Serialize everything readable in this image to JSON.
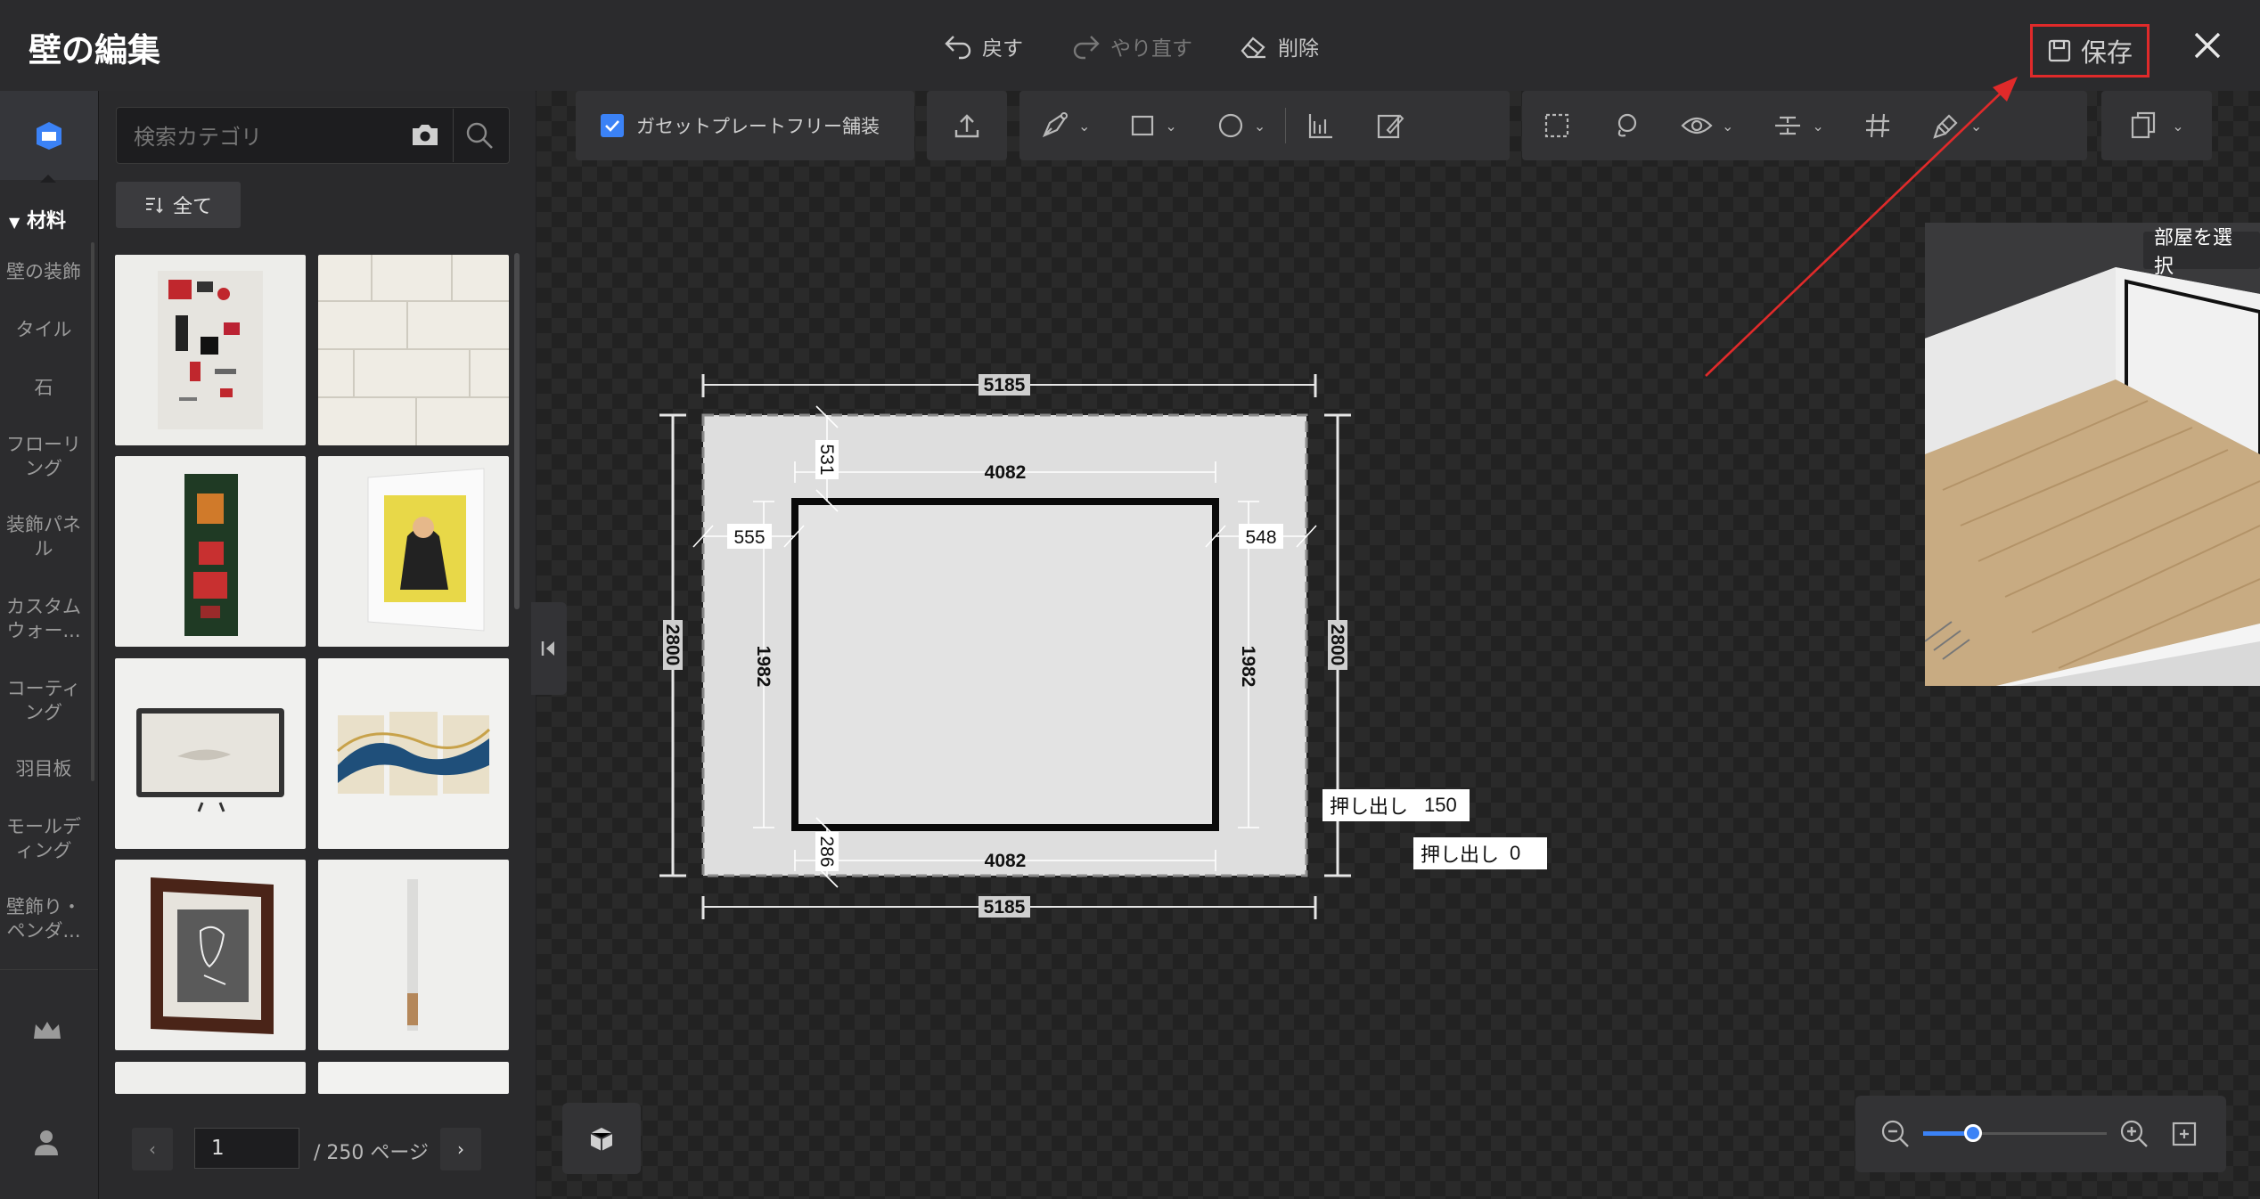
{
  "header": {
    "title": "壁の編集",
    "undo_label": "戻す",
    "redo_label": "やり直す",
    "delete_label": "削除",
    "save_label": "保存"
  },
  "rail": {
    "category_header": "材料",
    "categories": [
      [
        "壁の装飾"
      ],
      [
        "タイル"
      ],
      [
        "石"
      ],
      [
        "フローリ",
        "ング"
      ],
      [
        "装飾パネ",
        "ル"
      ],
      [
        "カスタム",
        "ウォー..."
      ],
      [
        "コーティ",
        "ング"
      ],
      [
        "羽目板"
      ],
      [
        "モールデ",
        "ィング"
      ],
      [
        "壁飾り・",
        "ペンダ..."
      ]
    ]
  },
  "panel": {
    "search_placeholder": "検索カテゴリ",
    "filter_label": "全て",
    "page_current": "1",
    "page_total": "/ 250 ページ"
  },
  "toolbar": {
    "gusset_label": "ガセットプレートフリー舗装",
    "gusset_checked": true
  },
  "preview": {
    "select_room_label": "部屋を選択"
  },
  "drawing": {
    "wall_width": "5185",
    "wall_height": "2800",
    "inner_width": "4082",
    "inner_height": "1982",
    "top_offset": "531",
    "bottom_offset": "286",
    "left_offset": "555",
    "right_offset": "548",
    "extrude_label": "押し出し",
    "extrude_inner": "150",
    "extrude_outer": "0"
  },
  "zoom": {
    "level": 0.27
  },
  "colors": {
    "accent": "#3b82f6",
    "highlight": "#e02a2a",
    "annotation": "#e02a2a"
  }
}
